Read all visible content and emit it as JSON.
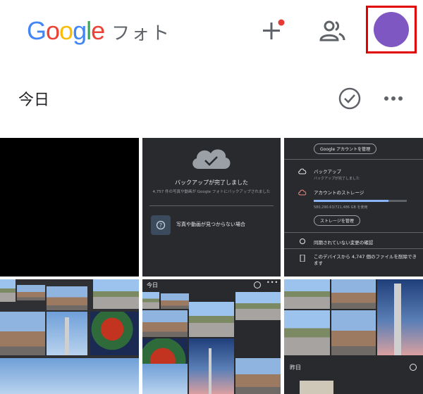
{
  "header": {
    "logo_letters": [
      "G",
      "o",
      "o",
      "g",
      "l",
      "e"
    ],
    "logo_colors": [
      "#4285F4",
      "#EA4335",
      "#FBBC05",
      "#4285F4",
      "#34A853",
      "#EA4335"
    ],
    "app_name": "フォト",
    "avatar_color": "#7E57C2",
    "notification_dot_color": "#E53935",
    "highlight_color": "#E00000"
  },
  "date_row": {
    "label": "今日"
  },
  "tiles": {
    "backup": {
      "title": "バックアップが完了しました",
      "subtitle": "4,757 件の写真や動画が Google フォトにバックアップされました",
      "help_text": "写真や動画が見つからない場合"
    },
    "account": {
      "manage_button": "Google アカウントを管理",
      "backup_title": "バックアップ",
      "backup_sub": "バックアップが完了しました",
      "storage_title": "アカウントのストレージ",
      "storage_used": "580,290.63/721,486 GB を使用",
      "storage_fraction": 0.8,
      "storage_button": "ストレージを管理",
      "unsynced_changes": "同期されていない変更の確認",
      "free_space": "このデバイスから 4,747 個のファイルを削除できます"
    },
    "grid_today_label": "今日",
    "grid_yesterday_label": "昨日",
    "small_label": "昨日"
  }
}
